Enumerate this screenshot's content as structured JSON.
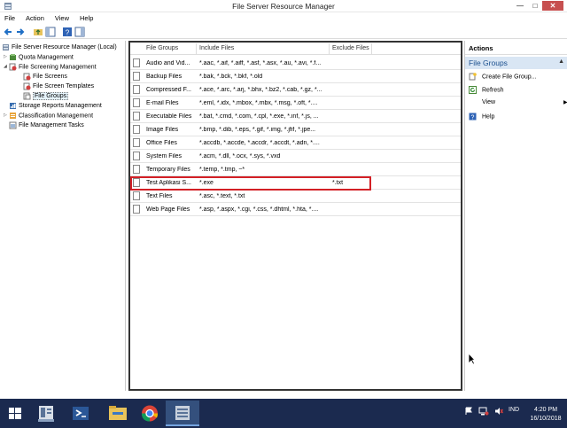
{
  "window": {
    "title": "File Server Resource Manager",
    "minimize_glyph": "—",
    "maximize_glyph": "□",
    "close_glyph": "✕"
  },
  "menu": [
    "File",
    "Action",
    "View",
    "Help"
  ],
  "tree": {
    "root": "File Server Resource Manager (Local)",
    "quota": "Quota Management",
    "screening": "File Screening Management",
    "file_screens": "File Screens",
    "templates": "File Screen Templates",
    "file_groups": "File Groups",
    "storage_reports": "Storage Reports Management",
    "classification": "Classification Management",
    "file_mgmt_tasks": "File Management Tasks"
  },
  "list": {
    "headers": [
      "File Groups",
      "Include Files",
      "Exclude Files"
    ],
    "rows": [
      {
        "name": "Audio and Vid...",
        "include": "*.aac, *.aif, *.aiff, *.asf, *.asx, *.au, *.avi, *.f...",
        "exclude": ""
      },
      {
        "name": "Backup Files",
        "include": "*.bak, *.bck, *.bkf, *.old",
        "exclude": ""
      },
      {
        "name": "Compressed F...",
        "include": "*.ace, *.arc, *.arj, *.bhx, *.bz2, *.cab, *.gz, *...",
        "exclude": ""
      },
      {
        "name": "E-mail Files",
        "include": "*.eml, *.idx, *.mbox, *.mbx, *.msg, *.oft, *....",
        "exclude": ""
      },
      {
        "name": "Executable Files",
        "include": "*.bat, *.cmd, *.com, *.cpl, *.exe, *.inf, *.js, ...",
        "exclude": ""
      },
      {
        "name": "Image Files",
        "include": "*.bmp, *.dib, *.eps, *.gif, *.img, *.jfif, *.jpe...",
        "exclude": ""
      },
      {
        "name": "Office Files",
        "include": "*.accdb, *.accde, *.accdr, *.accdt, *.adn, *....",
        "exclude": ""
      },
      {
        "name": "System Files",
        "include": "*.acm, *.dll, *.ocx, *.sys, *.vxd",
        "exclude": ""
      },
      {
        "name": "Temporary Files",
        "include": "*.temp, *.tmp, ~*",
        "exclude": ""
      },
      {
        "name": "Test Aplikasi S...",
        "include": "*.exe",
        "exclude": "*.txt"
      },
      {
        "name": "Text Files",
        "include": "*.asc, *.text, *.txt",
        "exclude": ""
      },
      {
        "name": "Web Page Files",
        "include": "*.asp, *.aspx, *.cgi, *.css, *.dhtml, *.hta, *....",
        "exclude": ""
      }
    ]
  },
  "actions": {
    "title": "Actions",
    "group": "File Groups",
    "items": [
      "Create File Group...",
      "Refresh",
      "View",
      "Help"
    ]
  },
  "taskbar": {
    "language": "IND",
    "time": "4:20 PM",
    "date": "16/10/2018"
  },
  "colors": {
    "highlight_border": "#d32026",
    "taskbar_bg": "#1b2a4f",
    "actions_group_bg": "#d9e6f4"
  }
}
